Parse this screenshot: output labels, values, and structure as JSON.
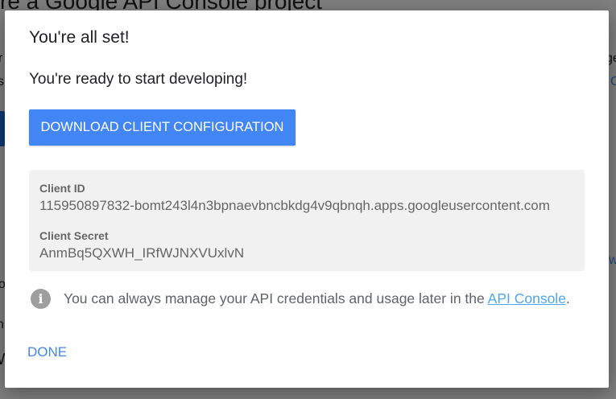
{
  "background": {
    "title": "re a Google API Console project",
    "fragments": [
      "r",
      "s",
      "I",
      "o",
      "n",
      "W",
      "ge",
      "C",
      "w"
    ]
  },
  "dialog": {
    "title": "You're all set!",
    "subtitle": "You're ready to start developing!",
    "download_button": "DOWNLOAD CLIENT CONFIGURATION",
    "credentials": {
      "client_id_label": "Client ID",
      "client_id_value": "115950897832-bomt243l4n3bpnaevbncbkdg4v9qbnqh.apps.googleusercontent.com",
      "client_secret_label": "Client Secret",
      "client_secret_value": "AnmBq5QXWH_IRfWJNXVUxlvN"
    },
    "info": {
      "text_before": "You can always manage your API credentials and usage later in the ",
      "link": "API Console",
      "text_after": "."
    },
    "done_button": "DONE",
    "colors": {
      "primary": "#4285f4",
      "link": "#4fa6e8"
    }
  }
}
